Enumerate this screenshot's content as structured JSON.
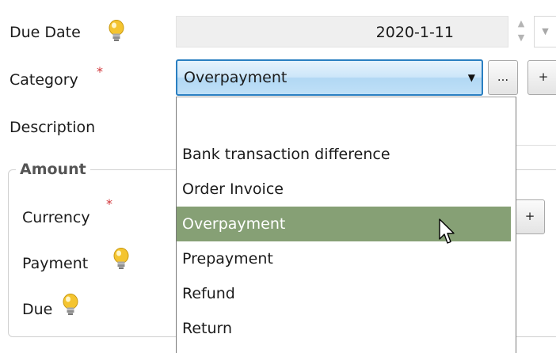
{
  "form": {
    "due_date_label": "Due Date",
    "due_date_value": "2020-1-11",
    "category_label": "Category",
    "category_required_mark": "*",
    "category_value": "Overpayment",
    "category_more_label": "...",
    "category_add_label": "+",
    "description_label": "Description"
  },
  "amount_group": {
    "legend": "Amount",
    "currency_label": "Currency",
    "currency_required_mark": "*",
    "currency_add_label": "+",
    "payment_label": "Payment",
    "due_label": "Due"
  },
  "category_dropdown": {
    "items": [
      "",
      "Bank transaction difference",
      "Order Invoice",
      "Overpayment",
      "Prepayment",
      "Refund",
      "Return"
    ],
    "selected_index": 3
  },
  "icons": {
    "hint": "lightbulb-icon",
    "spin_up": "chevron-up-icon",
    "spin_down": "chevron-down-icon",
    "dropdown_arrow": "caret-down-icon",
    "cursor": "mouse-cursor-icon"
  },
  "colors": {
    "combo_border": "#2a7fc1",
    "selected_item": "#86a075",
    "required": "#d13438",
    "bulb": "#f4c430"
  }
}
